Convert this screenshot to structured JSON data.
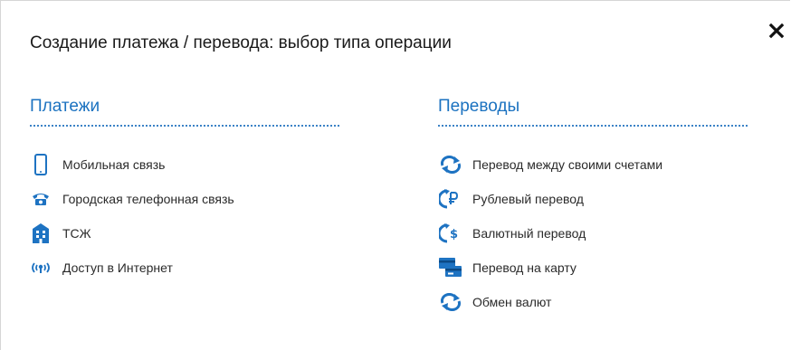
{
  "dialog": {
    "title": "Создание платежа / перевода: выбор типа операции",
    "close_icon": "close-icon"
  },
  "payments": {
    "heading": "Платежи",
    "items": [
      {
        "label": "Мобильная связь",
        "icon": "mobile-phone-icon"
      },
      {
        "label": "Городская телефонная связь",
        "icon": "telephone-icon"
      },
      {
        "label": "ТСЖ",
        "icon": "building-icon"
      },
      {
        "label": "Доступ в Интернет",
        "icon": "wifi-signal-icon"
      }
    ]
  },
  "transfers": {
    "heading": "Переводы",
    "items": [
      {
        "label": "Перевод между своими счетами",
        "icon": "exchange-arrows-icon"
      },
      {
        "label": "Рублевый перевод",
        "icon": "ruble-transfer-icon"
      },
      {
        "label": "Валютный перевод",
        "icon": "dollar-transfer-icon"
      },
      {
        "label": "Перевод на карту",
        "icon": "card-transfer-icon"
      },
      {
        "label": "Обмен валют",
        "icon": "exchange-arrows-icon"
      }
    ]
  },
  "colors": {
    "accent": "#1b72c0",
    "icon": "#1e73c2"
  }
}
